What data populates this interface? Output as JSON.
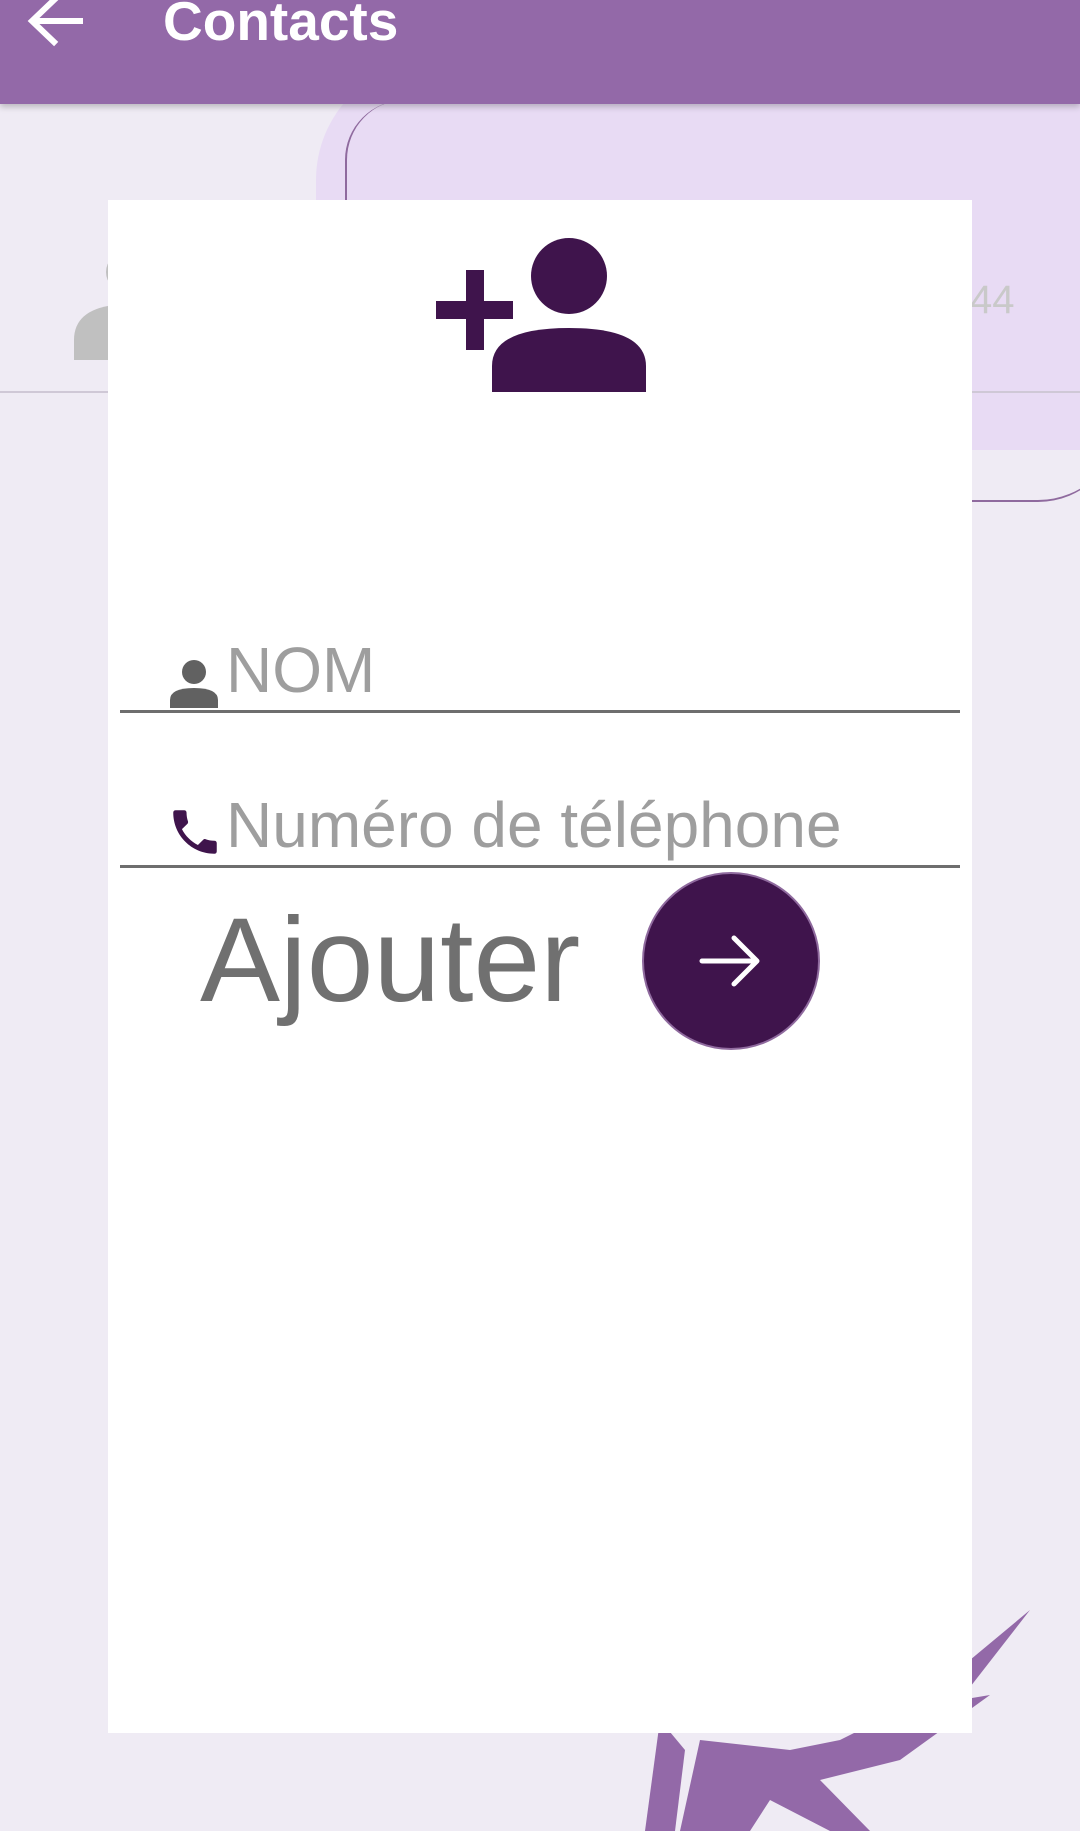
{
  "app_bar": {
    "title": "Contacts",
    "back_icon": "arrow-left-icon",
    "color": "#9369a8"
  },
  "background": {
    "time_fragment": "44"
  },
  "dialog": {
    "header_icon": "person-add-icon",
    "icon_color": "#3f144c",
    "fields": {
      "name": {
        "icon": "person-icon",
        "placeholder": "NOM",
        "value": ""
      },
      "phone": {
        "icon": "phone-icon",
        "placeholder": "Numéro de téléphone",
        "value": ""
      }
    },
    "submit": {
      "label": "Ajouter",
      "icon": "arrow-right-icon",
      "color": "#3f144c"
    }
  }
}
